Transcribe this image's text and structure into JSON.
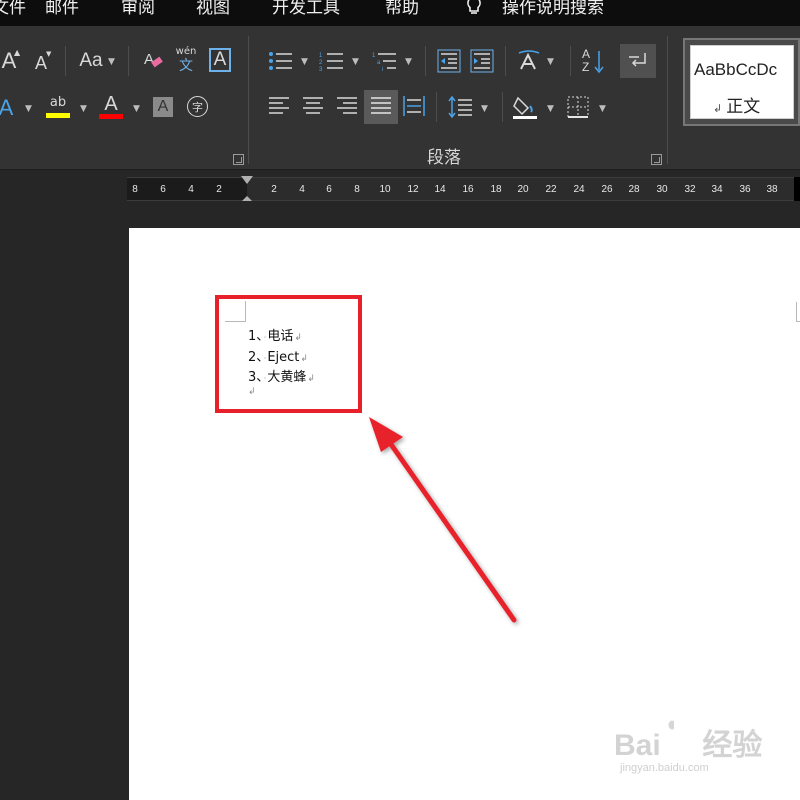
{
  "menubar": {
    "items": [
      "文件",
      "邮件",
      "审阅",
      "视图",
      "开发工具",
      "帮助"
    ],
    "tell_me": "操作说明搜索",
    "tell_me_icon": "lightbulb-icon"
  },
  "ribbon": {
    "font": {
      "grow_font": "A",
      "shrink_font": "A",
      "change_case": "Aa",
      "phonetic_top": "wén",
      "phonetic_bottom": "文",
      "char_border": "A",
      "text_effect": "A",
      "highlight": "ab",
      "font_color": "A",
      "char_shading": "A",
      "enclose_char": "字",
      "highlight_color": "#ffff00",
      "font_color_color": "#ff0000"
    },
    "paragraph": {
      "group_label": "段落",
      "sort_top": "A",
      "sort_bottom": "Z"
    },
    "styles": {
      "normal_sample": "AaBbCcDc",
      "normal_name": "正文",
      "return_mark": "↲"
    }
  },
  "ruler": {
    "left_ticks": [
      "8",
      "6",
      "4",
      "2"
    ],
    "right_ticks": [
      "2",
      "4",
      "6",
      "8",
      "10",
      "12",
      "14",
      "16",
      "18",
      "20",
      "22",
      "24",
      "26",
      "28",
      "30",
      "32",
      "34",
      "36",
      "38"
    ]
  },
  "document": {
    "list": [
      {
        "number": "1、",
        "text": "电话"
      },
      {
        "number": "2、",
        "text": "Eject"
      },
      {
        "number": "3、",
        "text": "大黄蜂"
      }
    ],
    "tab_mark": "·",
    "return_mark": "↲"
  },
  "annotation": {
    "color": "#e8202a"
  },
  "watermark": {
    "text": "Bai     经验",
    "url": "jingyan.baidu.com"
  }
}
